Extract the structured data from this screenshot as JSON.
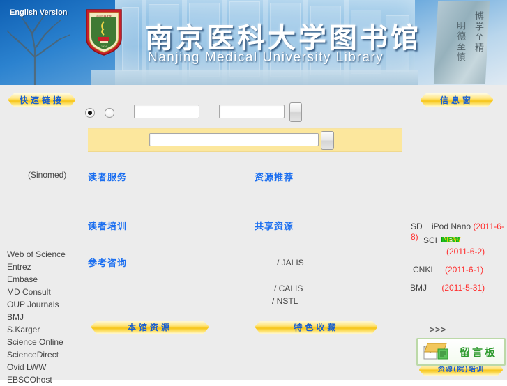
{
  "header": {
    "english_version": "English Version",
    "title_cn": "南京医科大学图书馆",
    "title_en": "Nanjing Medical University Library",
    "crest_icon": "university-crest-icon",
    "stone_text_right": "博学至精",
    "stone_text_left": "明德至慎"
  },
  "ribbons": {
    "quick_links": "快速链接",
    "info_window": "信息窗",
    "local_resources": "本馆资源",
    "special_collection": "特色收藏",
    "bottom_banner": "资源(院)培训"
  },
  "search": {
    "radio_a_selected": true,
    "radio_b_selected": false,
    "input_1_value": "",
    "input_2_value": "",
    "main_input_value": "",
    "go_button_label": "",
    "main_go_button_label": ""
  },
  "links": {
    "reader_service": "读者服务",
    "reader_training": "读者培训",
    "reference_consult": "参考咨询",
    "resource_recommend": "资源推荐",
    "shared_resources": "共享资源"
  },
  "plain_text": {
    "sinomed": "(Sinomed)",
    "jalis": "/ JALIS",
    "calis": "/ CALIS",
    "nstl": "/ NSTL"
  },
  "databases": [
    "Web of Science",
    "Entrez",
    "Embase",
    "MD Consult",
    "OUP Journals",
    "BMJ",
    "S.Karger",
    "Science Online",
    "ScienceDirect",
    "Ovid LWW",
    "EBSCOhost"
  ],
  "info_window": {
    "sci_label": "SCI",
    "new_badge": "NEW",
    "news": [
      {
        "label_a": "SD",
        "label_b": "iPod Nano",
        "date": "(2011-6-8)"
      },
      {
        "label_a": "",
        "label_b": "",
        "date": "(2011-6-2)"
      },
      {
        "label_a": "CNKI",
        "label_b": "",
        "date": "(2011-6-1)"
      },
      {
        "label_a": "BMJ",
        "label_b": "",
        "date": "(2011-5-31)"
      }
    ],
    "more": ">>>"
  },
  "message_board": {
    "label": "留言板",
    "icon": "envelope-icon"
  },
  "colors": {
    "page_bg": "#ececec",
    "link_blue": "#1a6ef0",
    "date_red": "#ff2d2d",
    "ribbon_gold": "#f6c518",
    "search_yellow": "#fce79d",
    "green_accent": "#2f9b2f"
  }
}
